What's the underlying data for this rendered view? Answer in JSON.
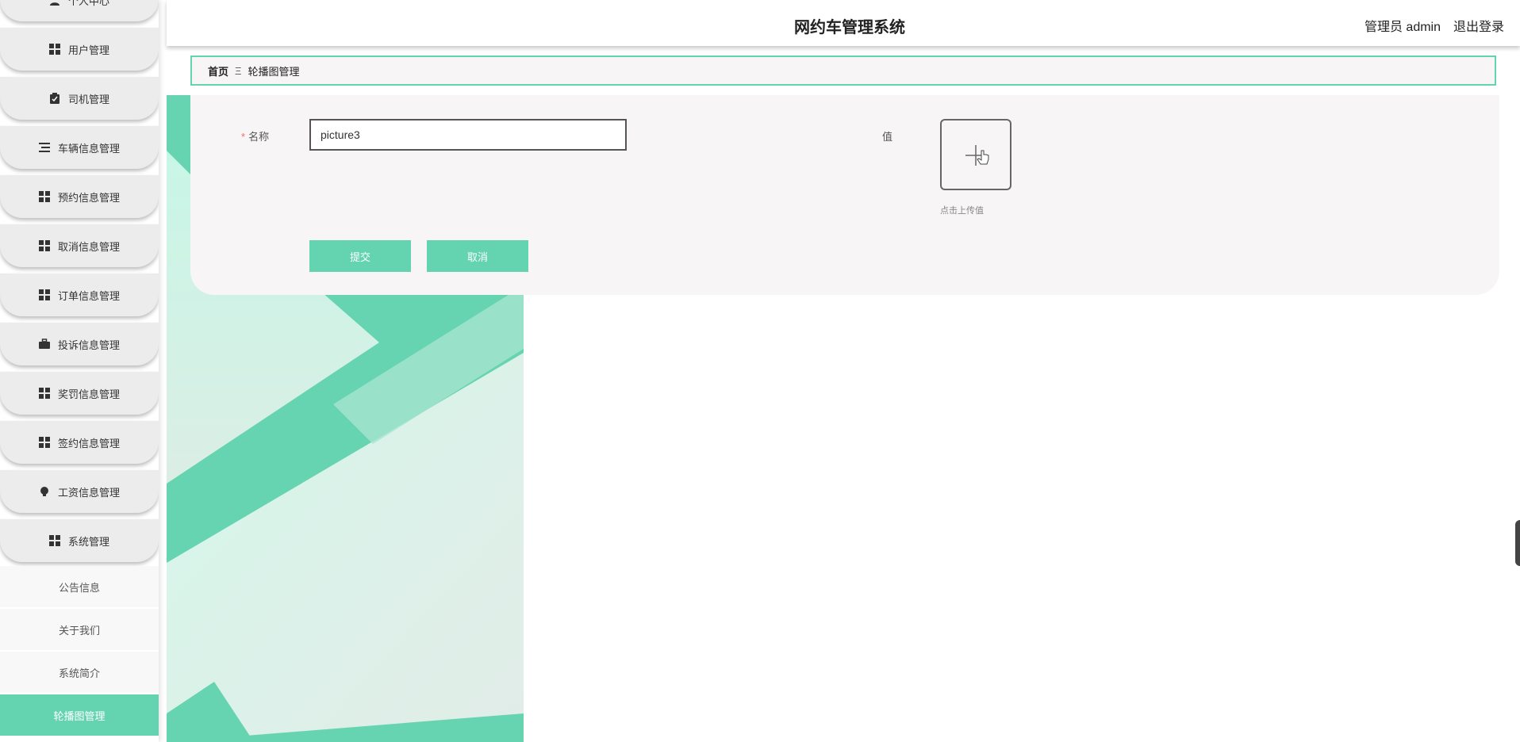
{
  "header": {
    "title": "网约车管理系统",
    "user": "管理员 admin",
    "logout": "退出登录"
  },
  "sidebar": {
    "items": [
      {
        "label": "个人中心",
        "icon": "person-icon"
      },
      {
        "label": "用户管理",
        "icon": "grid-icon"
      },
      {
        "label": "司机管理",
        "icon": "clipboard-icon"
      },
      {
        "label": "车辆信息管理",
        "icon": "list-icon"
      },
      {
        "label": "预约信息管理",
        "icon": "grid-icon"
      },
      {
        "label": "取消信息管理",
        "icon": "grid-icon"
      },
      {
        "label": "订单信息管理",
        "icon": "grid-icon"
      },
      {
        "label": "投诉信息管理",
        "icon": "briefcase-icon"
      },
      {
        "label": "奖罚信息管理",
        "icon": "grid-icon"
      },
      {
        "label": "签约信息管理",
        "icon": "grid-icon"
      },
      {
        "label": "工资信息管理",
        "icon": "bulb-icon"
      },
      {
        "label": "系统管理",
        "icon": "grid-icon"
      }
    ],
    "sub_items": [
      {
        "label": "公告信息"
      },
      {
        "label": "关于我们"
      },
      {
        "label": "系统简介"
      },
      {
        "label": "轮播图管理"
      }
    ],
    "active_sub": "轮播图管理"
  },
  "breadcrumb": {
    "home": "首页",
    "separator": "Ξ",
    "current": "轮播图管理"
  },
  "form": {
    "name_required_mark": "*",
    "name_label": "名称",
    "name_value": "picture3",
    "value_label": "值",
    "upload_tip": "点击上传值",
    "submit_label": "提交",
    "cancel_label": "取消"
  },
  "colors": {
    "accent": "#64d3b0",
    "panel_bg": "#f7f5f5",
    "menu_bg": "#ececec"
  }
}
